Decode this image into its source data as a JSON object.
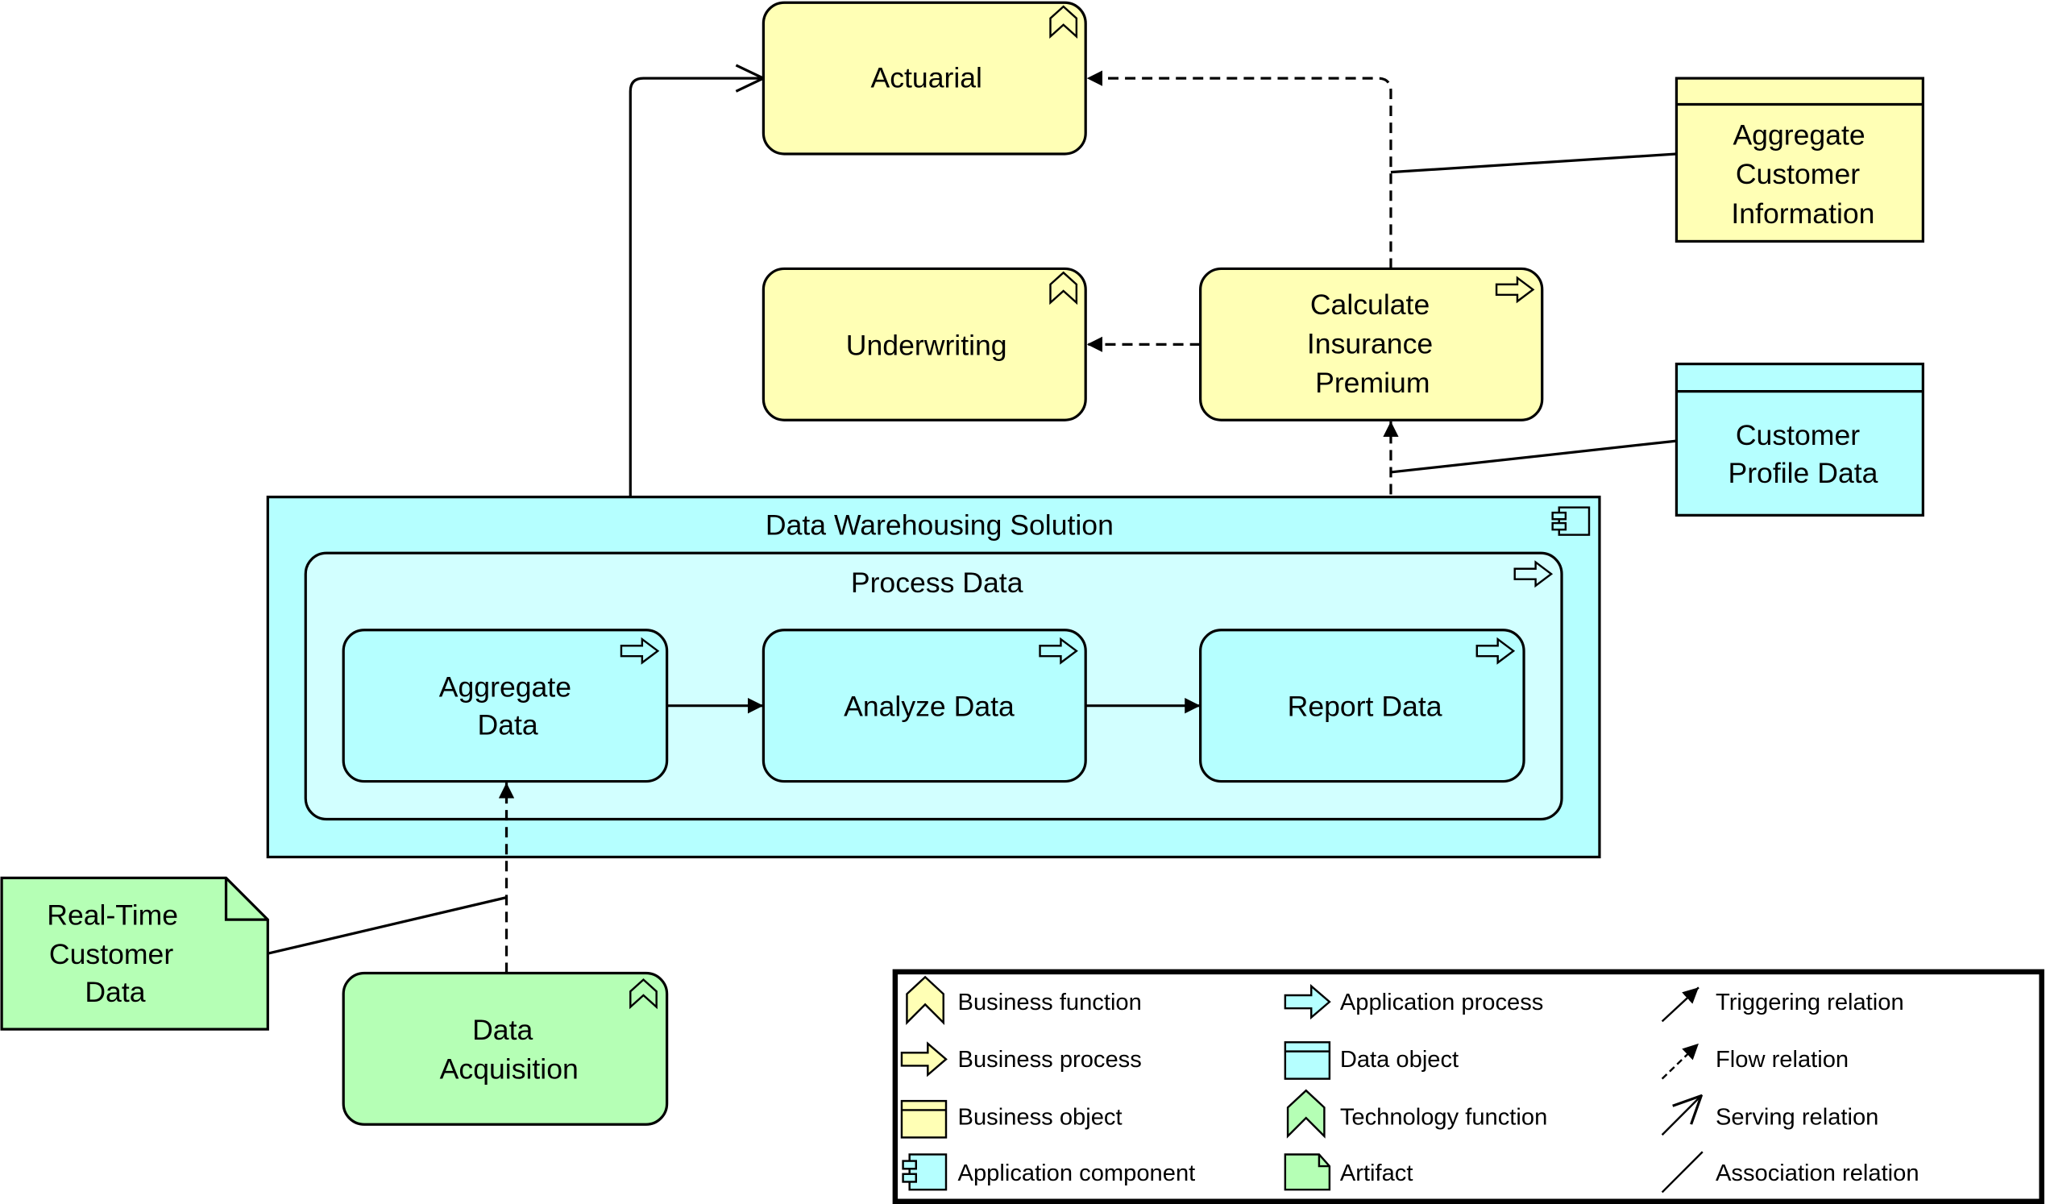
{
  "colors": {
    "business": "#ffffb5",
    "application": "#b5ffff",
    "application_inner": "#d2ffff",
    "technology": "#b5ffb5"
  },
  "elements": {
    "actuarial": {
      "label": "Actuarial",
      "type": "business-function"
    },
    "underwriting": {
      "label": "Underwriting",
      "type": "business-function"
    },
    "calculate_premium": {
      "lines": [
        "Calculate",
        "Insurance",
        "Premium"
      ],
      "type": "business-process"
    },
    "aggregate_customer_info": {
      "lines": [
        "Aggregate",
        "Customer",
        "Information"
      ],
      "type": "business-object"
    },
    "customer_profile_data": {
      "lines": [
        "Customer",
        "Profile Data"
      ],
      "type": "data-object"
    },
    "data_warehousing": {
      "label": "Data Warehousing Solution",
      "type": "application-component"
    },
    "process_data": {
      "label": "Process Data",
      "type": "application-process"
    },
    "aggregate_data": {
      "lines": [
        "Aggregate",
        "Data"
      ],
      "type": "application-process"
    },
    "analyze_data": {
      "label": "Analyze Data",
      "type": "application-process"
    },
    "report_data": {
      "label": "Report Data",
      "type": "application-process"
    },
    "realtime_customer_data": {
      "lines": [
        "Real-Time",
        "Customer",
        "Data"
      ],
      "type": "artifact"
    },
    "data_acquisition": {
      "lines": [
        "Data",
        "Acquisition"
      ],
      "type": "technology-function"
    }
  },
  "relations": [
    {
      "from": "Data Warehousing Solution",
      "to": "Actuarial",
      "type": "serving"
    },
    {
      "from": "Calculate Insurance Premium",
      "to": "Actuarial",
      "type": "flow"
    },
    {
      "from": "Calculate Insurance Premium",
      "to": "Underwriting",
      "type": "flow"
    },
    {
      "from": "Report Data",
      "to": "Calculate Insurance Premium",
      "type": "flow"
    },
    {
      "from": "Aggregate Data",
      "to": "Analyze Data",
      "type": "triggering"
    },
    {
      "from": "Analyze Data",
      "to": "Report Data",
      "type": "triggering"
    },
    {
      "from": "Data Acquisition",
      "to": "Aggregate Data",
      "type": "flow"
    },
    {
      "from": "Aggregate Customer Information",
      "to": "flow to Actuarial",
      "type": "association"
    },
    {
      "from": "Customer Profile Data",
      "to": "flow to Calculate Insurance Premium",
      "type": "association"
    },
    {
      "from": "Real-Time Customer Data",
      "to": "flow to Aggregate Data",
      "type": "association"
    }
  ],
  "legend": {
    "items": [
      {
        "label": "Business function",
        "icon": "business-function-icon"
      },
      {
        "label": "Business process",
        "icon": "business-process-icon"
      },
      {
        "label": "Business object",
        "icon": "business-object-icon"
      },
      {
        "label": "Application component",
        "icon": "application-component-icon"
      },
      {
        "label": "Application process",
        "icon": "application-process-icon"
      },
      {
        "label": "Data object",
        "icon": "data-object-icon"
      },
      {
        "label": "Technology function",
        "icon": "technology-function-icon"
      },
      {
        "label": "Artifact",
        "icon": "artifact-icon"
      },
      {
        "label": "Triggering relation",
        "icon": "triggering-relation-icon"
      },
      {
        "label": "Flow relation",
        "icon": "flow-relation-icon"
      },
      {
        "label": "Serving relation",
        "icon": "serving-relation-icon"
      },
      {
        "label": "Association relation",
        "icon": "association-relation-icon"
      }
    ]
  }
}
